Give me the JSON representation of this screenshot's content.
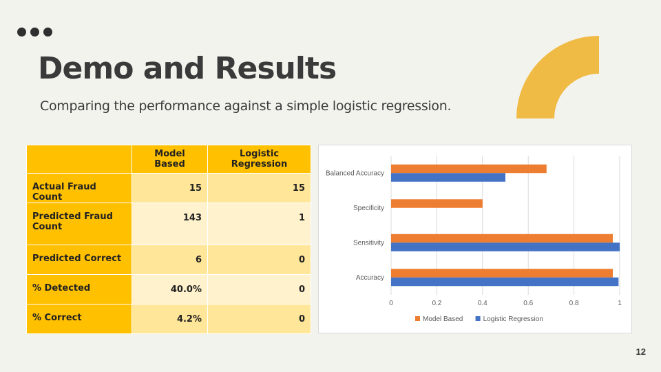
{
  "slide": {
    "title": "Demo and Results",
    "subtitle": "Comparing the performance against a simple logistic regression.",
    "page_number": "12"
  },
  "colors": {
    "accent": "#ffc000",
    "arc": "#f0bb45",
    "model_based": "#ed7d31",
    "logistic_regression": "#4472c4"
  },
  "table": {
    "headers": [
      "",
      "Model Based",
      "Logistic Regression"
    ],
    "rows": [
      {
        "label": "Actual Fraud Count",
        "model_based": "15",
        "logistic_regression": "15"
      },
      {
        "label": "Predicted Fraud Count",
        "model_based": "143",
        "logistic_regression": "1"
      },
      {
        "label": "Predicted Correct",
        "model_based": "6",
        "logistic_regression": "0"
      },
      {
        "label": "% Detected",
        "model_based": "40.0%",
        "logistic_regression": "0"
      },
      {
        "label": "% Correct",
        "model_based": "4.2%",
        "logistic_regression": "0"
      }
    ]
  },
  "chart_data": {
    "type": "bar",
    "orientation": "horizontal",
    "categories": [
      "Balanced Accuracy",
      "Specificity",
      "Sensitivity",
      "Accuracy"
    ],
    "series": [
      {
        "name": "Model Based",
        "color": "#ed7d31",
        "values": [
          0.68,
          0.4,
          0.97,
          0.97
        ]
      },
      {
        "name": "Logistic Regression",
        "color": "#4472c4",
        "values": [
          0.5,
          0,
          1.0,
          0.995
        ]
      }
    ],
    "xlim": [
      0,
      1
    ],
    "xticks": [
      "0",
      "0.2",
      "0.4",
      "0.6",
      "0.8",
      "1"
    ],
    "grid": true,
    "legend": "bottom"
  }
}
